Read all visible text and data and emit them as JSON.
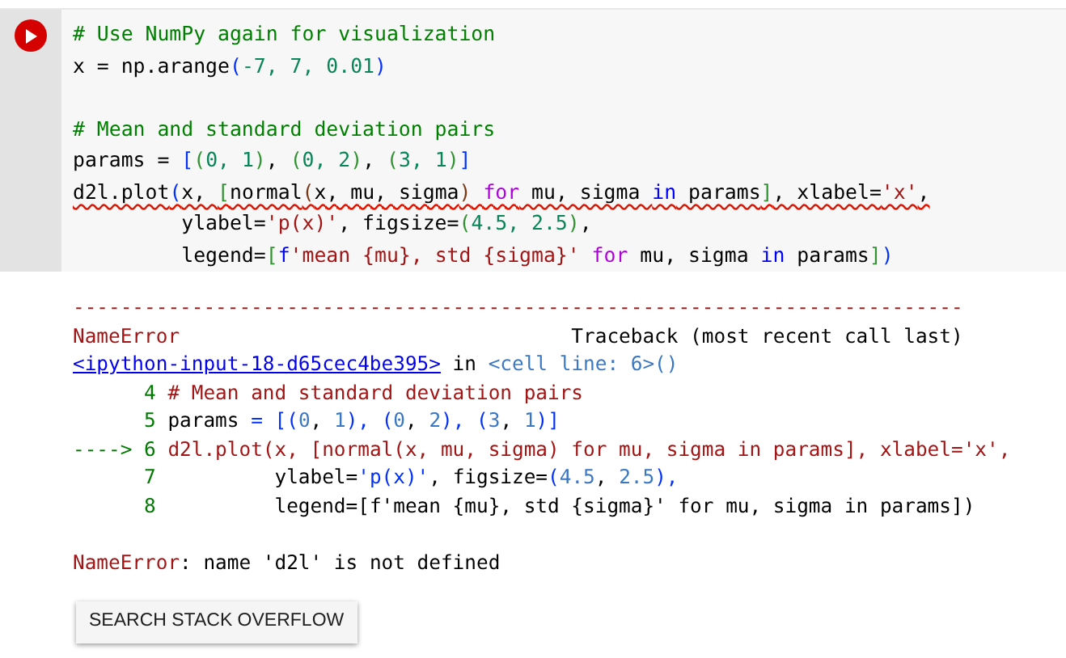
{
  "code_cell": {
    "run_button": {
      "kind": "run"
    },
    "lines": [
      {
        "kind": "code",
        "tokens": [
          {
            "text": "# Use NumPy again for visualization",
            "kind": "comment"
          }
        ]
      },
      {
        "kind": "code",
        "tokens": [
          {
            "text": "x = np.arange",
            "kind": "plain"
          },
          {
            "text": "(",
            "kind": "bracket"
          },
          {
            "text": "-7, 7, 0.01",
            "kind": "number"
          },
          {
            "text": ")",
            "kind": "bracket"
          }
        ]
      },
      {
        "kind": "blank"
      },
      {
        "kind": "code",
        "tokens": [
          {
            "text": "# Mean and standard deviation pairs",
            "kind": "comment"
          }
        ]
      },
      {
        "kind": "code",
        "tokens": [
          {
            "text": "params = ",
            "kind": "plain"
          },
          {
            "text": "[",
            "kind": "bracket"
          },
          {
            "text": "(",
            "kind": "bracket2"
          },
          {
            "text": "0, 1",
            "kind": "number"
          },
          {
            "text": ")",
            "kind": "bracket2"
          },
          {
            "text": ", ",
            "kind": "plain"
          },
          {
            "text": "(",
            "kind": "bracket2"
          },
          {
            "text": "0, 2",
            "kind": "number"
          },
          {
            "text": ")",
            "kind": "bracket2"
          },
          {
            "text": ", ",
            "kind": "plain"
          },
          {
            "text": "(",
            "kind": "bracket2"
          },
          {
            "text": "3, 1",
            "kind": "number"
          },
          {
            "text": ")",
            "kind": "bracket2"
          },
          {
            "text": "]",
            "kind": "bracket"
          }
        ]
      },
      {
        "kind": "code",
        "error_underline": true,
        "tokens": [
          {
            "text": "d2l.plot",
            "kind": "plain"
          },
          {
            "text": "(",
            "kind": "bracket"
          },
          {
            "text": "x, ",
            "kind": "plain"
          },
          {
            "text": "[",
            "kind": "bracket2"
          },
          {
            "text": "normal",
            "kind": "plain"
          },
          {
            "text": "(",
            "kind": "bracket3"
          },
          {
            "text": "x, mu, sigma",
            "kind": "plain"
          },
          {
            "text": ")",
            "kind": "bracket3"
          },
          {
            "text": " for",
            "kind": "keyword"
          },
          {
            "text": " mu, sigma ",
            "kind": "plain"
          },
          {
            "text": "in",
            "kind": "keyword2"
          },
          {
            "text": " params",
            "kind": "plain"
          },
          {
            "text": "]",
            "kind": "bracket2"
          },
          {
            "text": ", xlabel=",
            "kind": "plain"
          },
          {
            "text": "'x'",
            "kind": "string"
          },
          {
            "text": ",",
            "kind": "plain"
          }
        ]
      },
      {
        "kind": "code",
        "tokens": [
          {
            "text": "         ylabel=",
            "kind": "plain"
          },
          {
            "text": "'p(x)'",
            "kind": "string"
          },
          {
            "text": ", figsize=",
            "kind": "plain"
          },
          {
            "text": "(",
            "kind": "bracket2"
          },
          {
            "text": "4.5, 2.5",
            "kind": "number"
          },
          {
            "text": ")",
            "kind": "bracket2"
          },
          {
            "text": ",",
            "kind": "plain"
          }
        ]
      },
      {
        "kind": "code",
        "tokens": [
          {
            "text": "         legend=",
            "kind": "plain"
          },
          {
            "text": "[",
            "kind": "bracket2"
          },
          {
            "text": "f",
            "kind": "keyword2"
          },
          {
            "text": "'mean {mu}, std {sigma}'",
            "kind": "string"
          },
          {
            "text": " for",
            "kind": "keyword"
          },
          {
            "text": " mu, sigma ",
            "kind": "plain"
          },
          {
            "text": "in",
            "kind": "keyword2"
          },
          {
            "text": " params",
            "kind": "plain"
          },
          {
            "text": "]",
            "kind": "bracket2"
          },
          {
            "text": ")",
            "kind": "bracket"
          }
        ]
      }
    ]
  },
  "output": {
    "lines": [
      {
        "kind": "code",
        "tokens": [
          {
            "text": "---------------------------------------------------------------------------",
            "kind": "error"
          }
        ]
      },
      {
        "kind": "code",
        "tokens": [
          {
            "text": "NameError",
            "kind": "error"
          },
          {
            "text": "                                 Traceback (most recent call last)",
            "kind": "plain"
          }
        ]
      },
      {
        "kind": "code",
        "tokens": [
          {
            "text": "<ipython-input-18-d65cec4be395>",
            "kind": "link"
          },
          {
            "text": " in ",
            "kind": "plain"
          },
          {
            "text": "<cell line: 6>()",
            "kind": "cyan"
          }
        ]
      },
      {
        "kind": "code",
        "tokens": [
          {
            "text": "      4 ",
            "kind": "lineno"
          },
          {
            "text": "# Mean and standard deviation pairs",
            "kind": "error"
          }
        ]
      },
      {
        "kind": "code",
        "tokens": [
          {
            "text": "      5 ",
            "kind": "lineno"
          },
          {
            "text": "params ",
            "kind": "plain"
          },
          {
            "text": "= [(",
            "kind": "bracket"
          },
          {
            "text": "0",
            "kind": "cyan"
          },
          {
            "text": ", ",
            "kind": "plain"
          },
          {
            "text": "1",
            "kind": "cyan"
          },
          {
            "text": "), (",
            "kind": "bracket"
          },
          {
            "text": "0",
            "kind": "cyan"
          },
          {
            "text": ", ",
            "kind": "plain"
          },
          {
            "text": "2",
            "kind": "cyan"
          },
          {
            "text": "), (",
            "kind": "bracket"
          },
          {
            "text": "3",
            "kind": "cyan"
          },
          {
            "text": ", ",
            "kind": "plain"
          },
          {
            "text": "1",
            "kind": "cyan"
          },
          {
            "text": ")]",
            "kind": "bracket"
          }
        ]
      },
      {
        "kind": "code",
        "tokens": [
          {
            "text": "----> 6 ",
            "kind": "lineno"
          },
          {
            "text": "d2l.plot(x, [normal(x, mu, sigma) for mu, sigma in params], xlabel='x',",
            "kind": "error"
          }
        ]
      },
      {
        "kind": "code",
        "tokens": [
          {
            "text": "      7 ",
            "kind": "lineno"
          },
          {
            "text": "         ylabel=",
            "kind": "plain"
          },
          {
            "text": "'p(x)'",
            "kind": "bracket"
          },
          {
            "text": ", figsize=",
            "kind": "plain"
          },
          {
            "text": "(",
            "kind": "bracket"
          },
          {
            "text": "4.5",
            "kind": "cyan"
          },
          {
            "text": ", ",
            "kind": "plain"
          },
          {
            "text": "2.5",
            "kind": "cyan"
          },
          {
            "text": "),",
            "kind": "bracket"
          }
        ]
      },
      {
        "kind": "code",
        "tokens": [
          {
            "text": "      8 ",
            "kind": "lineno"
          },
          {
            "text": "         legend=[f'mean {mu}, std {sigma}' for mu, sigma in params])",
            "kind": "plain"
          }
        ]
      },
      {
        "kind": "blank"
      },
      {
        "kind": "code",
        "tokens": [
          {
            "text": "NameError",
            "kind": "error"
          },
          {
            "text": ": name 'd2l' is not defined",
            "kind": "plain"
          }
        ]
      }
    ]
  },
  "search_button": {
    "label": "SEARCH STACK OVERFLOW"
  }
}
